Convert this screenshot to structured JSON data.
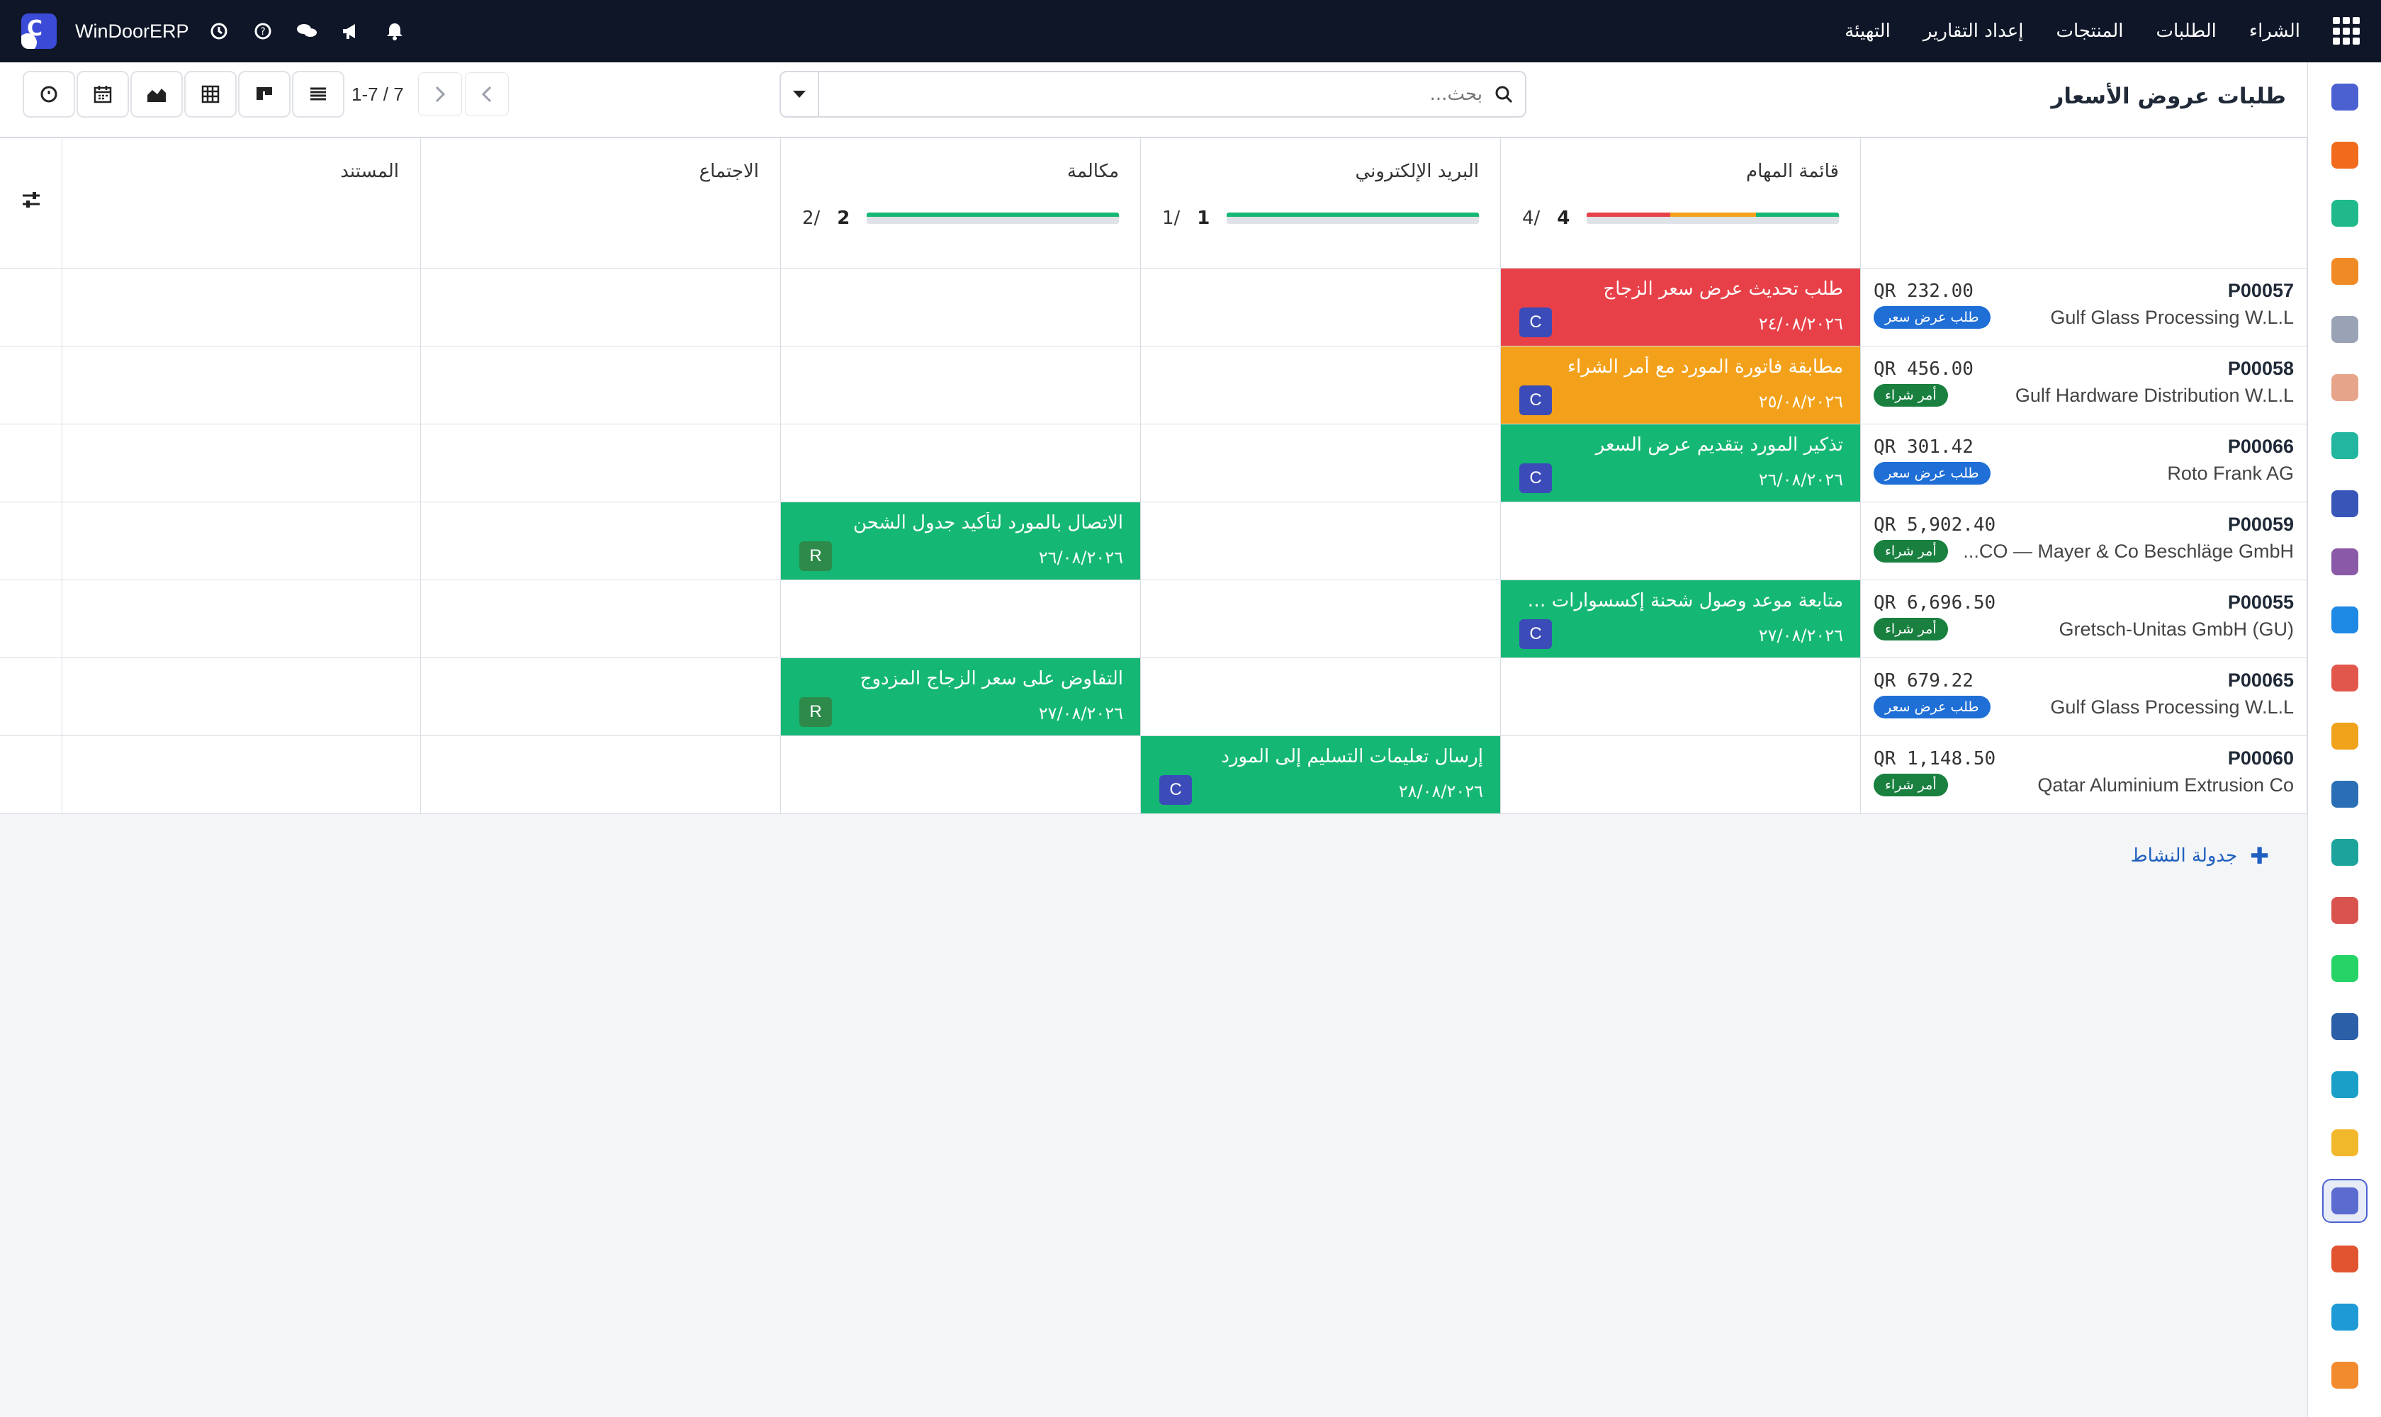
{
  "navbar": {
    "menu": [
      "الشراء",
      "الطلبات",
      "المنتجات",
      "إعداد التقارير",
      "التهيئة"
    ],
    "company": "WinDoorERP"
  },
  "control": {
    "title": "طلبات عروض الأسعار",
    "search_placeholder": "بحث...",
    "pager_value": "1-7 / 7"
  },
  "columns": [
    {
      "label": "قائمة المهام",
      "count": "4",
      "total": "/4",
      "progress": [
        {
          "color": "#e84048",
          "pct": 33
        },
        {
          "color": "#f3a11a",
          "pct": 34
        },
        {
          "color": "#14b773",
          "pct": 33
        }
      ]
    },
    {
      "label": "البريد الإلكتروني",
      "count": "1",
      "total": "/1",
      "progress": [
        {
          "color": "#14b773",
          "pct": 100
        }
      ]
    },
    {
      "label": "مكالمة",
      "count": "2",
      "total": "/2",
      "progress": [
        {
          "color": "#14b773",
          "pct": 100
        }
      ]
    },
    {
      "label": "الاجتماع"
    },
    {
      "label": "المستند"
    }
  ],
  "records": [
    {
      "name": "P00057",
      "amount": "QR 232.00",
      "partner": "Gulf Glass Processing W.L.L",
      "badge": "طلب عرض سعر",
      "badge_type": "rfq"
    },
    {
      "name": "P00058",
      "amount": "QR 456.00",
      "partner": "Gulf Hardware Distribution W.L.L",
      "badge": "أمر شراء",
      "badge_type": "po"
    },
    {
      "name": "P00066",
      "amount": "QR 301.42",
      "partner": "Roto Frank AG",
      "badge": "طلب عرض سعر",
      "badge_type": "rfq"
    },
    {
      "name": "P00059",
      "amount": "QR 5,902.40",
      "partner": "...CO — Mayer & Co Beschläge GmbH",
      "badge": "أمر شراء",
      "badge_type": "po"
    },
    {
      "name": "P00055",
      "amount": "QR 6,696.50",
      "partner": "Gretsch-Unitas GmbH (GU)",
      "badge": "أمر شراء",
      "badge_type": "po"
    },
    {
      "name": "P00065",
      "amount": "QR 679.22",
      "partner": "Gulf Glass Processing W.L.L",
      "badge": "طلب عرض سعر",
      "badge_type": "rfq"
    },
    {
      "name": "P00060",
      "amount": "QR 1,148.50",
      "partner": "Qatar Aluminium Extrusion Co",
      "badge": "أمر شراء",
      "badge_type": "po"
    }
  ],
  "activities": [
    {
      "row": 0,
      "col": 0,
      "title": "طلب تحديث عرض سعر الزجاج",
      "date": "٢٤/٠٨/٢٠٢٦",
      "user": "C",
      "state": "red"
    },
    {
      "row": 1,
      "col": 0,
      "title": "مطابقة فاتورة المورد مع أمر الشراء",
      "date": "٢٥/٠٨/٢٠٢٦",
      "user": "C",
      "state": "orange"
    },
    {
      "row": 2,
      "col": 0,
      "title": "تذكير المورد بتقديم عرض السعر",
      "date": "٢٦/٠٨/٢٠٢٦",
      "user": "C",
      "state": "green"
    },
    {
      "row": 3,
      "col": 2,
      "title": "الاتصال بالمورد لتأكيد جدول الشحن",
      "date": "٢٦/٠٨/٢٠٢٦",
      "user": "R",
      "state": "green"
    },
    {
      "row": 4,
      "col": 0,
      "title": "متابعة موعد وصول شحنة إكسسوارات I-JET...",
      "date": "٢٧/٠٨/٢٠٢٦",
      "user": "C",
      "state": "green"
    },
    {
      "row": 5,
      "col": 2,
      "title": "التفاوض على سعر الزجاج المزدوج",
      "date": "٢٧/٠٨/٢٠٢٦",
      "user": "R",
      "state": "green"
    },
    {
      "row": 6,
      "col": 1,
      "title": "إرسال تعليمات التسليم إلى المورد",
      "date": "٢٨/٠٨/٢٠٢٦",
      "user": "C",
      "state": "green"
    }
  ],
  "footer": {
    "schedule_label": "جدولة النشاط"
  },
  "sidebar_apps": [
    {
      "name": "mail-app-icon",
      "color": "#4b61d1"
    },
    {
      "name": "chat-app-icon",
      "color": "#f26b1d"
    },
    {
      "name": "sales-app-icon",
      "color": "#1fb98b"
    },
    {
      "name": "reports-app-icon",
      "color": "#f08a24"
    },
    {
      "name": "inventory-app-icon",
      "color": "#9aa3b5"
    },
    {
      "name": "contacts-app-icon",
      "color": "#e6a58a"
    },
    {
      "name": "tasks-app-icon",
      "color": "#22b6a0"
    },
    {
      "name": "crm-app-icon",
      "color": "#3856b8"
    },
    {
      "name": "products-app-icon",
      "color": "#8a5aa8"
    },
    {
      "name": "invoice-app-icon",
      "color": "#1e88e5"
    },
    {
      "name": "employees-app-icon",
      "color": "#e2574c"
    },
    {
      "name": "calendar-app-icon",
      "color": "#f1a21b"
    },
    {
      "name": "sign-app-icon",
      "color": "#2a6fb5"
    },
    {
      "name": "timesheet-app-icon",
      "color": "#1ba39c"
    },
    {
      "name": "dashboard-app-icon",
      "color": "#d9534f"
    },
    {
      "name": "whatsapp-app-icon",
      "color": "#25d366"
    },
    {
      "name": "discuss-app-icon",
      "color": "#2b5fa8"
    },
    {
      "name": "website-app-icon",
      "color": "#1aa0c8"
    },
    {
      "name": "telegram-app-icon",
      "color": "#f2b82b"
    },
    {
      "name": "purchase-app-icon",
      "color": "#5b6bd0"
    },
    {
      "name": "manufacturing-app-icon",
      "color": "#e2542f"
    },
    {
      "name": "studio-app-icon",
      "color": "#1e9bd7"
    },
    {
      "name": "settings-app-icon",
      "color": "#f28a2e"
    }
  ]
}
